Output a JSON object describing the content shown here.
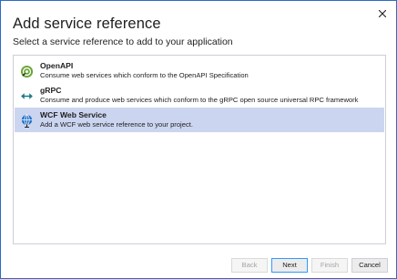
{
  "dialog": {
    "title": "Add service reference",
    "subtitle": "Select a service reference to add to your application"
  },
  "services": [
    {
      "name": "OpenAPI",
      "description": "Consume web services which conform to the OpenAPI Specification",
      "icon": "openapi-icon",
      "selected": false
    },
    {
      "name": "gRPC",
      "description": "Consume and produce web services which conform to the gRPC open source universal RPC framework",
      "icon": "grpc-arrows-icon",
      "selected": false
    },
    {
      "name": "WCF Web Service",
      "description": "Add a WCF web service reference to your project.",
      "icon": "wcf-globe-icon",
      "selected": true
    }
  ],
  "buttons": {
    "back": "Back",
    "next": "Next",
    "finish": "Finish",
    "cancel": "Cancel"
  },
  "colors": {
    "selection": "#ccd5f0",
    "accent": "#2b6cc4",
    "openapi_green": "#6ba539",
    "grpc_teal": "#1b7a8c"
  }
}
